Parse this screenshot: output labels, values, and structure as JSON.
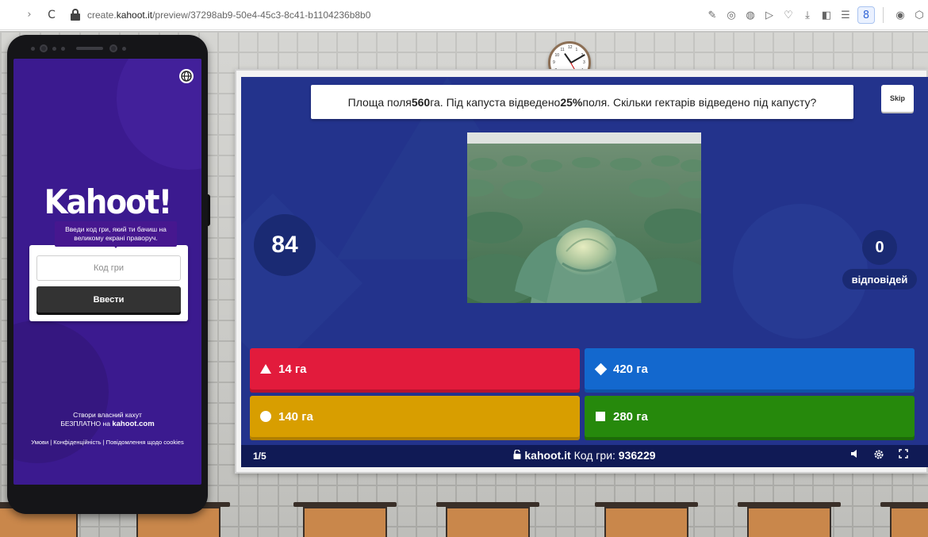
{
  "browser": {
    "back_glyph": "›",
    "reload_glyph": "C",
    "url_prefix": "create.",
    "url_host": "kahoot.it",
    "url_path": "/preview/37298ab9-50e4-45c3-8c41-b1104236b8b0",
    "toolbar_icons": [
      "edit-icon",
      "camera-icon",
      "shield-icon",
      "play-icon",
      "heart-icon",
      "download-icon",
      "sidebar-icon",
      "menu-icon",
      "profile-icon",
      "globe-icon",
      "cube-icon"
    ],
    "toolbar_glyphs": [
      "✎",
      "◎",
      "◍",
      "▷",
      "♡",
      "⤓",
      "◧",
      "☰",
      "8",
      "◉",
      "⬡"
    ]
  },
  "phone": {
    "logo": "Kahoot!",
    "tooltip": "Введи код гри, який ти бачиш на великому екрані праворуч.",
    "pin_placeholder": "Код гри",
    "enter_label": "Ввести",
    "footer_line1": "Створи власний кахут",
    "footer_line2_prefix": "БЕЗПЛАТНО на ",
    "footer_line2_link": "kahoot.com",
    "links": "Умови | Конфіденційність | Повідомлення щодо cookies"
  },
  "game": {
    "question_prefix": "Площа поля ",
    "question_num1": "560",
    "question_mid": " га. Під капуста відведено ",
    "question_num2": "25%",
    "question_suffix": " поля. Скільки гектарів відведено під капусту?",
    "skip_label": "Skip",
    "image_subject": "cabbage-field",
    "timer": "84",
    "answers_count": "0",
    "answers_label": "відповідей",
    "answers": [
      {
        "shape": "triangle",
        "label": "14 га",
        "color": "#e21b3c"
      },
      {
        "shape": "diamond",
        "label": "420 га",
        "color": "#1368ce"
      },
      {
        "shape": "circle",
        "label": "140 га",
        "color": "#d89e00"
      },
      {
        "shape": "square",
        "label": "280 га",
        "color": "#26890c"
      }
    ],
    "footer": {
      "counter": "1/5",
      "lock_glyph": "🔓",
      "host": "kahoot.it",
      "pin_label": " Код гри: ",
      "pin": "936229",
      "controls": [
        "volume-icon",
        "settings-icon",
        "fullscreen-icon"
      ],
      "control_glyphs": [
        "◂",
        "⚙",
        "⛶"
      ]
    }
  },
  "clock_numbers": [
    "12",
    "1",
    "2",
    "3",
    "4",
    "5",
    "6",
    "7",
    "8",
    "9",
    "10",
    "11"
  ]
}
